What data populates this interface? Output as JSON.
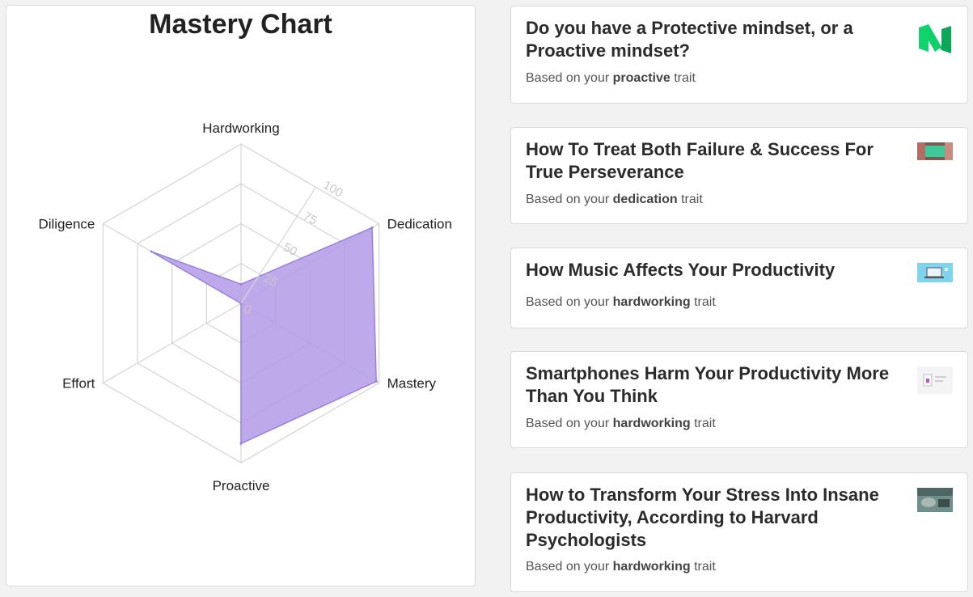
{
  "chart_data": {
    "type": "radar",
    "title": "Mastery Chart",
    "axes": [
      "Hardworking",
      "Dedication",
      "Mastery",
      "Proactive",
      "Effort",
      "Diligence"
    ],
    "range": [
      0,
      100
    ],
    "ticks": [
      0,
      25,
      50,
      75,
      100
    ],
    "series": [
      {
        "values": [
          12,
          95,
          98,
          88,
          0,
          65
        ]
      }
    ],
    "grid": true,
    "fill_color": "#b39be6",
    "stroke_color": "#9b7fe0",
    "grid_color": "#d4d4d4"
  },
  "articles": [
    {
      "title": "Do you have a Protective mindset, or a Proactive mindset?",
      "based_prefix": "Based on your",
      "trait": "proactive",
      "suffix": "trait",
      "thumb": "medium-logo-icon"
    },
    {
      "title": "How To Treat Both Failure & Success For True Perseverance",
      "based_prefix": "Based on your",
      "trait": "dedication",
      "suffix": "trait",
      "thumb": "article-photo-icon"
    },
    {
      "title": "How Music Affects Your Productivity",
      "based_prefix": "Based on your",
      "trait": "hardworking",
      "suffix": "trait",
      "thumb": "laptop-illustration-icon"
    },
    {
      "title": "Smartphones Harm Your Productivity More Than You Think",
      "based_prefix": "Based on your",
      "trait": "hardworking",
      "suffix": "trait",
      "thumb": "phone-illustration-icon"
    },
    {
      "title": "How to Transform Your Stress Into Insane Productivity, According to Harvard Psychologists",
      "based_prefix": "Based on your",
      "trait": "hardworking",
      "suffix": "trait",
      "thumb": "desk-photo-icon"
    }
  ]
}
